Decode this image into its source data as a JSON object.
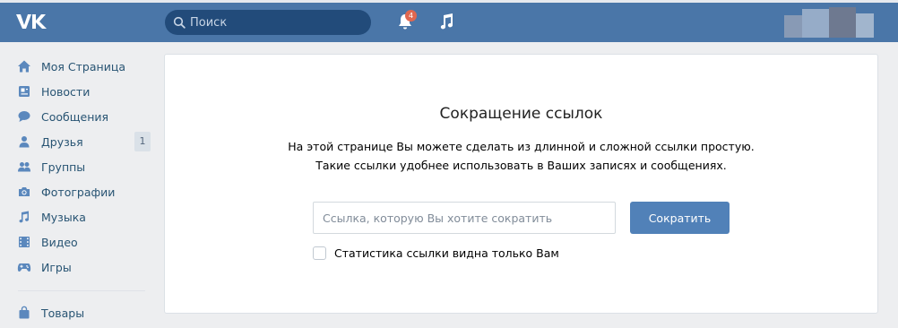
{
  "header": {
    "search_placeholder": "Поиск",
    "notifications_count": "4",
    "icons": [
      "vk-logo-icon",
      "search-icon",
      "bell-icon",
      "music-icon"
    ]
  },
  "sidebar": {
    "items": [
      {
        "label": "Моя Страница",
        "icon": "home-icon"
      },
      {
        "label": "Новости",
        "icon": "news-icon"
      },
      {
        "label": "Сообщения",
        "icon": "messages-icon"
      },
      {
        "label": "Друзья",
        "icon": "friends-icon",
        "count": "1"
      },
      {
        "label": "Группы",
        "icon": "groups-icon"
      },
      {
        "label": "Фотографии",
        "icon": "camera-icon"
      },
      {
        "label": "Музыка",
        "icon": "music-icon"
      },
      {
        "label": "Видео",
        "icon": "video-icon"
      },
      {
        "label": "Игры",
        "icon": "gamepad-icon"
      }
    ],
    "secondary": [
      {
        "label": "Товары",
        "icon": "bag-icon"
      }
    ]
  },
  "main": {
    "title": "Сокращение ссылок",
    "description_line1": "На этой странице Вы можете сделать из длинной и сложной ссылки простую.",
    "description_line2": "Такие ссылки удобнее использовать в Ваших записях и сообщениях.",
    "input_placeholder": "Ссылка, которую Вы хотите сократить",
    "input_value": "",
    "button_label": "Сократить",
    "checkbox_label": "Статистика ссылки видна только Вам",
    "checkbox_checked": false
  },
  "colors": {
    "header": "#4a76a8",
    "search_bg": "#224b7a",
    "button": "#5181b8",
    "link_text": "#285473",
    "page_bg": "#edeef0",
    "badge": "#e0674f"
  }
}
